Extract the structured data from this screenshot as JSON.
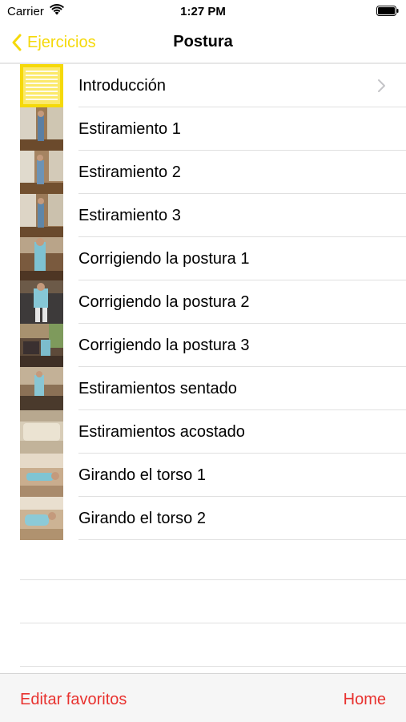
{
  "status_bar": {
    "carrier": "Carrier",
    "time": "1:27 PM",
    "wifi_icon": "wifi-icon",
    "battery_icon": "battery-icon"
  },
  "nav": {
    "back_label": "Ejercicios",
    "title": "Postura",
    "back_icon": "chevron-left-icon"
  },
  "list": {
    "items": [
      {
        "label": "Introducción",
        "thumb": "intro-lines",
        "has_chevron": true
      },
      {
        "label": "Estiramiento 1",
        "thumb": "photo"
      },
      {
        "label": "Estiramiento 2",
        "thumb": "photo"
      },
      {
        "label": "Estiramiento 3",
        "thumb": "photo"
      },
      {
        "label": "Corrigiendo la postura 1",
        "thumb": "photo"
      },
      {
        "label": "Corrigiendo la postura 2",
        "thumb": "photo"
      },
      {
        "label": "Corrigiendo la postura 3",
        "thumb": "photo"
      },
      {
        "label": "Estiramientos sentado",
        "thumb": "photo"
      },
      {
        "label": "Estiramientos acostado",
        "thumb": "photo"
      },
      {
        "label": "Girando el torso 1",
        "thumb": "photo"
      },
      {
        "label": "Girando el torso 2",
        "thumb": "photo"
      }
    ]
  },
  "toolbar": {
    "left_label": "Editar favoritos",
    "right_label": "Home"
  },
  "colors": {
    "accent_yellow": "#f5d90a",
    "toolbar_red": "#e8322f",
    "separator": "#e0e0e0"
  }
}
